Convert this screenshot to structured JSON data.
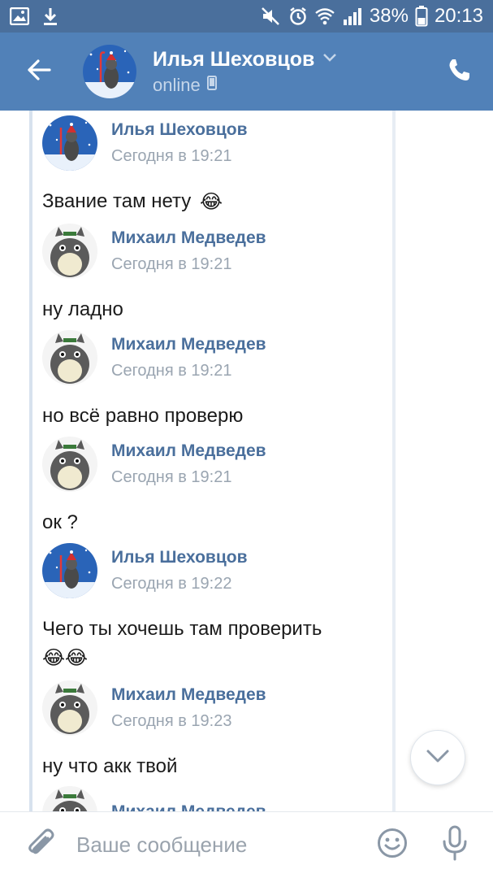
{
  "status_bar": {
    "battery": "38%",
    "time": "20:13",
    "icons": [
      "image-icon",
      "download-icon",
      "mute-icon",
      "alarm-icon",
      "wifi-icon",
      "signal-icon",
      "battery-icon"
    ]
  },
  "header": {
    "name": "Илья Шеховцов",
    "status": "online",
    "icons": [
      "back-arrow-icon",
      "chevron-down-icon",
      "phone-device-icon",
      "phone-call-icon"
    ]
  },
  "messages": [
    {
      "author": "Илья Шеховцов",
      "time": "Сегодня в 19:21",
      "lines": [
        "Звание там нету"
      ],
      "emoji": "😂",
      "avatar": "raccoon"
    },
    {
      "author": "Михаил Медведев",
      "time": "Сегодня в 19:21",
      "lines": [
        "ну ладно"
      ],
      "avatar": "totoro"
    },
    {
      "author": "Михаил Медведев",
      "time": "Сегодня в 19:21",
      "lines": [
        "но всё равно проверю"
      ],
      "avatar": "totoro"
    },
    {
      "author": "Михаил Медведев",
      "time": "Сегодня в 19:21",
      "lines": [
        "ок ?"
      ],
      "avatar": "totoro"
    },
    {
      "author": "Илья Шеховцов",
      "time": "Сегодня в 19:22",
      "lines": [
        "Чего ты хочешь там проверить"
      ],
      "emoji": "😂😂",
      "avatar": "raccoon"
    },
    {
      "author": "Михаил Медведев",
      "time": "Сегодня в 19:23",
      "lines": [
        "ну что акк твой"
      ],
      "avatar": "totoro"
    },
    {
      "author": "Михаил Медведев",
      "time": "",
      "lines": [],
      "avatar": "totoro"
    }
  ],
  "composer": {
    "placeholder": "Ваше сообщение",
    "icons": [
      "paperclip-icon",
      "smile-icon",
      "microphone-icon"
    ]
  },
  "colors": {
    "status_bar": "#4a6f9c",
    "header": "#5181b8",
    "author": "#4a6f9c",
    "time": "#9aa5b1"
  }
}
